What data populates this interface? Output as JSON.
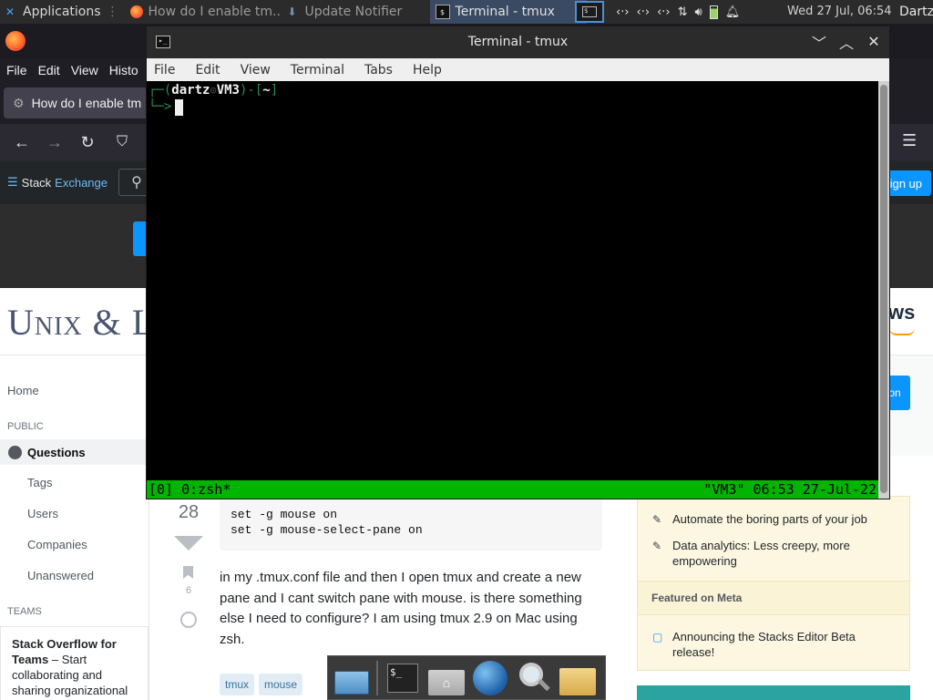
{
  "panel": {
    "apps_label": "Applications",
    "tasks": [
      {
        "label": "How do I enable tm...",
        "state": "dim"
      },
      {
        "label": "Update Notifier",
        "state": "dim"
      },
      {
        "label": "Terminal - tmux",
        "state": "active"
      }
    ],
    "tray_icons": [
      "network-icon",
      "network-icon",
      "network-icon",
      "transfer-icon",
      "volume-icon",
      "battery-icon",
      "notification-bell-icon"
    ],
    "clock": "Wed 27 Jul, 06:54",
    "user": "Dartz"
  },
  "firefox": {
    "menu": [
      "File",
      "Edit",
      "View",
      "Histo"
    ],
    "tab_title": "How do I enable tm",
    "stackexchange_logo": {
      "part1": "Stack",
      "part2": "Exchange"
    },
    "signup_label": "ign up"
  },
  "site": {
    "name": "Unix & L",
    "ad_label": "ws",
    "join_label": "on"
  },
  "sidebar": {
    "home": "Home",
    "public_head": "PUBLIC",
    "questions": "Questions",
    "items": [
      "Tags",
      "Users",
      "Companies",
      "Unanswered"
    ],
    "teams_head": "TEAMS",
    "sof_title": "Stack Overflow for Teams",
    "sof_text": " – Start collaborating and sharing organizational"
  },
  "post": {
    "vote_count": "28",
    "bookmark_count": "6",
    "code_lines": "set -g mouse on\nset -g mouse-select-pane on",
    "body": "in my .tmux.conf file and then I open tmux and create a new pane and I cant switch pane with mouse. is there something else I need to configure? I am using tmux 2.9 on Mac using zsh.",
    "tags": [
      "tmux",
      "mouse"
    ]
  },
  "right_column": {
    "blog_items": [
      "Automate the boring parts of your job",
      "Data analytics: Less creepy, more empowering"
    ],
    "meta_head": "Featured on Meta",
    "meta_items": [
      "Announcing the Stacks Editor Beta release!"
    ]
  },
  "dock": {
    "icons": [
      "show-desktop-icon",
      "terminal-icon",
      "home-folder-icon",
      "web-browser-icon",
      "search-icon",
      "folder-icon"
    ]
  },
  "terminal": {
    "title": "Terminal - tmux",
    "menu": [
      "File",
      "Edit",
      "View",
      "Terminal",
      "Tabs",
      "Help"
    ],
    "prompt_user": "dartz",
    "prompt_host": "VM3",
    "prompt_dir": "~",
    "tmux_left": "[0] 0:zsh*",
    "tmux_right": "\"VM3\" 06:53 27-Jul-22"
  }
}
